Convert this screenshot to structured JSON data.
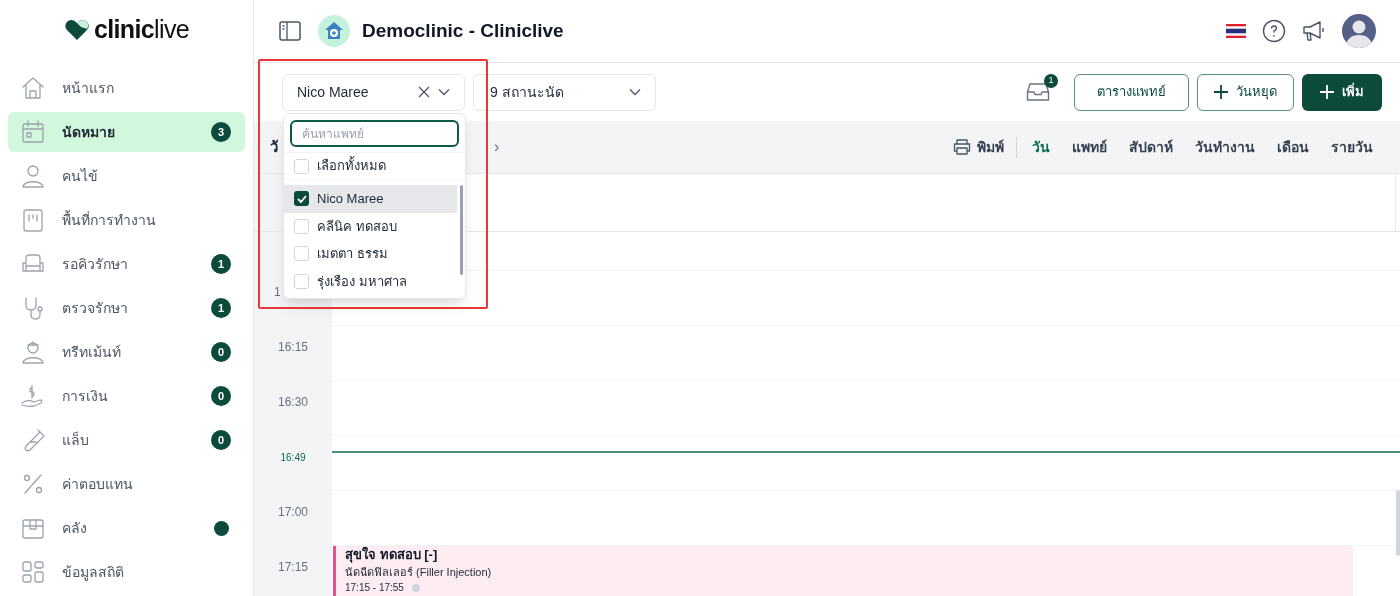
{
  "sidebar": {
    "logo": {
      "bold": "clinic",
      "light": "live"
    },
    "items": [
      {
        "label": "หน้าแรก",
        "selected": false
      },
      {
        "label": "นัดหมาย",
        "selected": true,
        "badge": "3"
      },
      {
        "label": "คนไข้",
        "selected": false
      },
      {
        "label": "พื้นที่การทำงาน",
        "selected": false
      },
      {
        "label": "รอคิวรักษา",
        "selected": false,
        "badge": "1"
      },
      {
        "label": "ตรวจรักษา",
        "selected": false,
        "badge": "1"
      },
      {
        "label": "ทรีทเม้นท์",
        "selected": false,
        "badge": "0"
      },
      {
        "label": "การเงิน",
        "selected": false,
        "badge": "0"
      },
      {
        "label": "แล็บ",
        "selected": false,
        "badge": "0"
      },
      {
        "label": "ค่าตอบแทน",
        "selected": false
      },
      {
        "label": "คลัง",
        "selected": false,
        "dot": true
      },
      {
        "label": "ข้อมูลสถิติ",
        "selected": false
      }
    ]
  },
  "header": {
    "title": "Democlinic - Cliniclive"
  },
  "filters": {
    "doctor": {
      "value": "Nico Maree",
      "clearable": true
    },
    "status": {
      "value": "9 สถานะนัด"
    }
  },
  "dropdown": {
    "search_placeholder": "ค้นหาแพทย์",
    "select_all": {
      "label": "เลือกทั้งหมด",
      "checked": false
    },
    "options": [
      {
        "label": "Nico Maree",
        "checked": true,
        "selected": true
      },
      {
        "label": "คลีนิค ทดสอบ",
        "checked": false,
        "selected": false
      },
      {
        "label": "เมตตา ธรรม",
        "checked": false,
        "selected": false
      },
      {
        "label": "รุ่งเรือง มหาศาล",
        "checked": false,
        "selected": false
      }
    ]
  },
  "inbox_badge": "1",
  "actions": [
    {
      "label": "ตารางแพทย์",
      "kind": "outline"
    },
    {
      "label": "วันหยุด",
      "kind": "outline-plus"
    },
    {
      "label": "เพิ่ม",
      "kind": "primary-plus"
    }
  ],
  "calendar_toolbar": {
    "date_label": "วั",
    "nav_next": "›",
    "print": "พิมพ์",
    "views": [
      {
        "label": "วัน",
        "selected": true
      },
      {
        "label": "แพทย์",
        "selected": false
      },
      {
        "label": "สัปดาห์",
        "selected": false
      },
      {
        "label": "วันทำงาน",
        "selected": false
      },
      {
        "label": "เดือน",
        "selected": false
      },
      {
        "label": "รายวัน",
        "selected": false
      }
    ]
  },
  "slots": [
    {
      "label": "1"
    },
    {
      "label": "16:15"
    },
    {
      "label": "16:30"
    },
    {
      "now": "16:49"
    },
    {
      "label": "17:00"
    },
    {
      "label": "17:15",
      "event": {
        "title": "สุขใจ ทดสอบ [-]",
        "service": "นัดฉีดฟิลเลอร์ (Filler Injection)",
        "time": "17:15 - 17:55"
      }
    }
  ],
  "annotation": {
    "kind": "highlight-rectangle"
  }
}
